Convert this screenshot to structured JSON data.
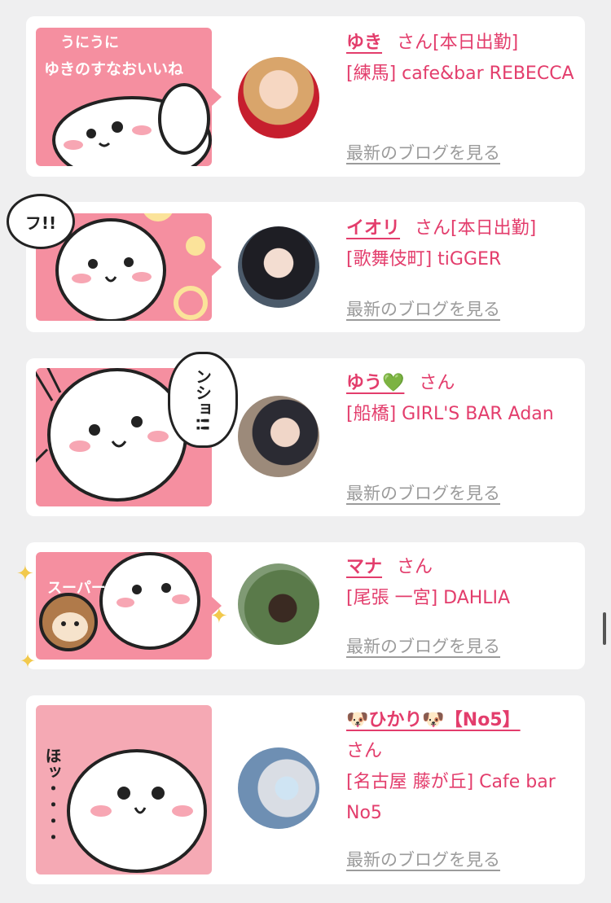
{
  "colors": {
    "accent": "#e33d6c",
    "sticker_pink": "#f58fa0",
    "muted": "#9b9b9b",
    "background": "#efeff0"
  },
  "entries": [
    {
      "name": "ゆき",
      "suffix": "さん",
      "tag": "[本日出勤]",
      "shop": "[練馬] cafe&bar REBECCA",
      "blog_link": "最新のブログを見る",
      "sticker_text": "ゆきのすなおいいね",
      "sticker_extra": "うにうに"
    },
    {
      "name": "イオリ",
      "suffix": "さん",
      "tag": "[本日出勤]",
      "shop": "[歌舞伎町] tiGGER",
      "blog_link": "最新のブログを見る",
      "sticker_text": "フ!!"
    },
    {
      "name": "ゆう💚",
      "suffix": "さん",
      "tag": "",
      "shop": "[船橋] GIRL'S BAR Adan",
      "blog_link": "最新のブログを見る",
      "sticker_text": "ンショ!!"
    },
    {
      "name": "マナ",
      "suffix": "さん",
      "tag": "",
      "shop": "[尾張 一宮] DAHLIA",
      "blog_link": "最新のブログを見る",
      "sticker_text": "スーパー"
    },
    {
      "name": "🐶ひかり🐶【No5】",
      "suffix": "さん",
      "tag": "",
      "shop": "[名古屋 藤が丘] Cafe bar No5",
      "blog_link": "最新のブログを見る",
      "sticker_text": "ほッ・・・・"
    }
  ]
}
